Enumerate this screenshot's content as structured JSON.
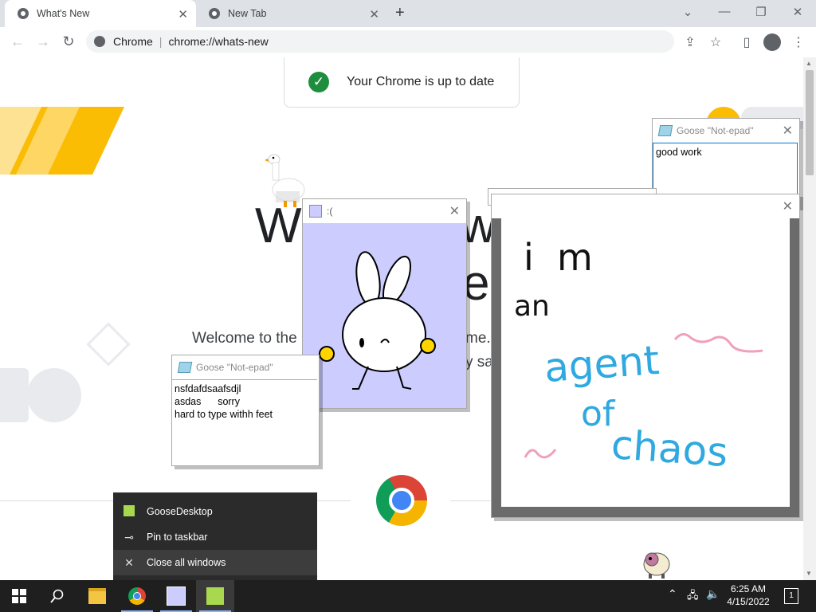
{
  "browser": {
    "tabs": [
      {
        "label": "What's New",
        "active": true
      },
      {
        "label": "New Tab",
        "active": false
      }
    ],
    "new_tab_symbol": "+",
    "omnibox": {
      "site_label": "Chrome",
      "url": "chrome://whats-new"
    }
  },
  "page": {
    "update_status": "Your Chrome is up to date",
    "heading_left": "W",
    "heading_right": "w",
    "heading_second": "e",
    "welcome_left": "Welcome to the",
    "welcome_right": "me.",
    "welcome_right2": "y sa"
  },
  "windows": {
    "notepad_top": {
      "title": "Goose \"Not-epad\"",
      "text": "good work"
    },
    "notepad_left": {
      "title": "Goose \"Not-epad\"",
      "text": "nsfdafdsaafsdjl\nasdas      sorry\nhard to type withh feet"
    },
    "meme_window": {
      "title": ":("
    },
    "drawing_window": {
      "line1": "i  m",
      "line2": "an",
      "line3": "agent",
      "line4": "of",
      "line5": "chaos"
    }
  },
  "jumplist": {
    "items": [
      {
        "label": "GooseDesktop",
        "icon": "goose-app-icon"
      },
      {
        "label": "Pin to taskbar",
        "icon": "pin-icon"
      },
      {
        "label": "Close all windows",
        "icon": "close-icon"
      }
    ]
  },
  "taskbar": {
    "time": "6:25 AM",
    "date": "4/15/2022",
    "notification_count": "1"
  },
  "colors": {
    "drawing_black": "#111111",
    "drawing_blue": "#2fa9e0",
    "drawing_pink": "#f0a0b8",
    "meme_bg": "#ccccff",
    "accent_yellow": "#fbbc04"
  }
}
